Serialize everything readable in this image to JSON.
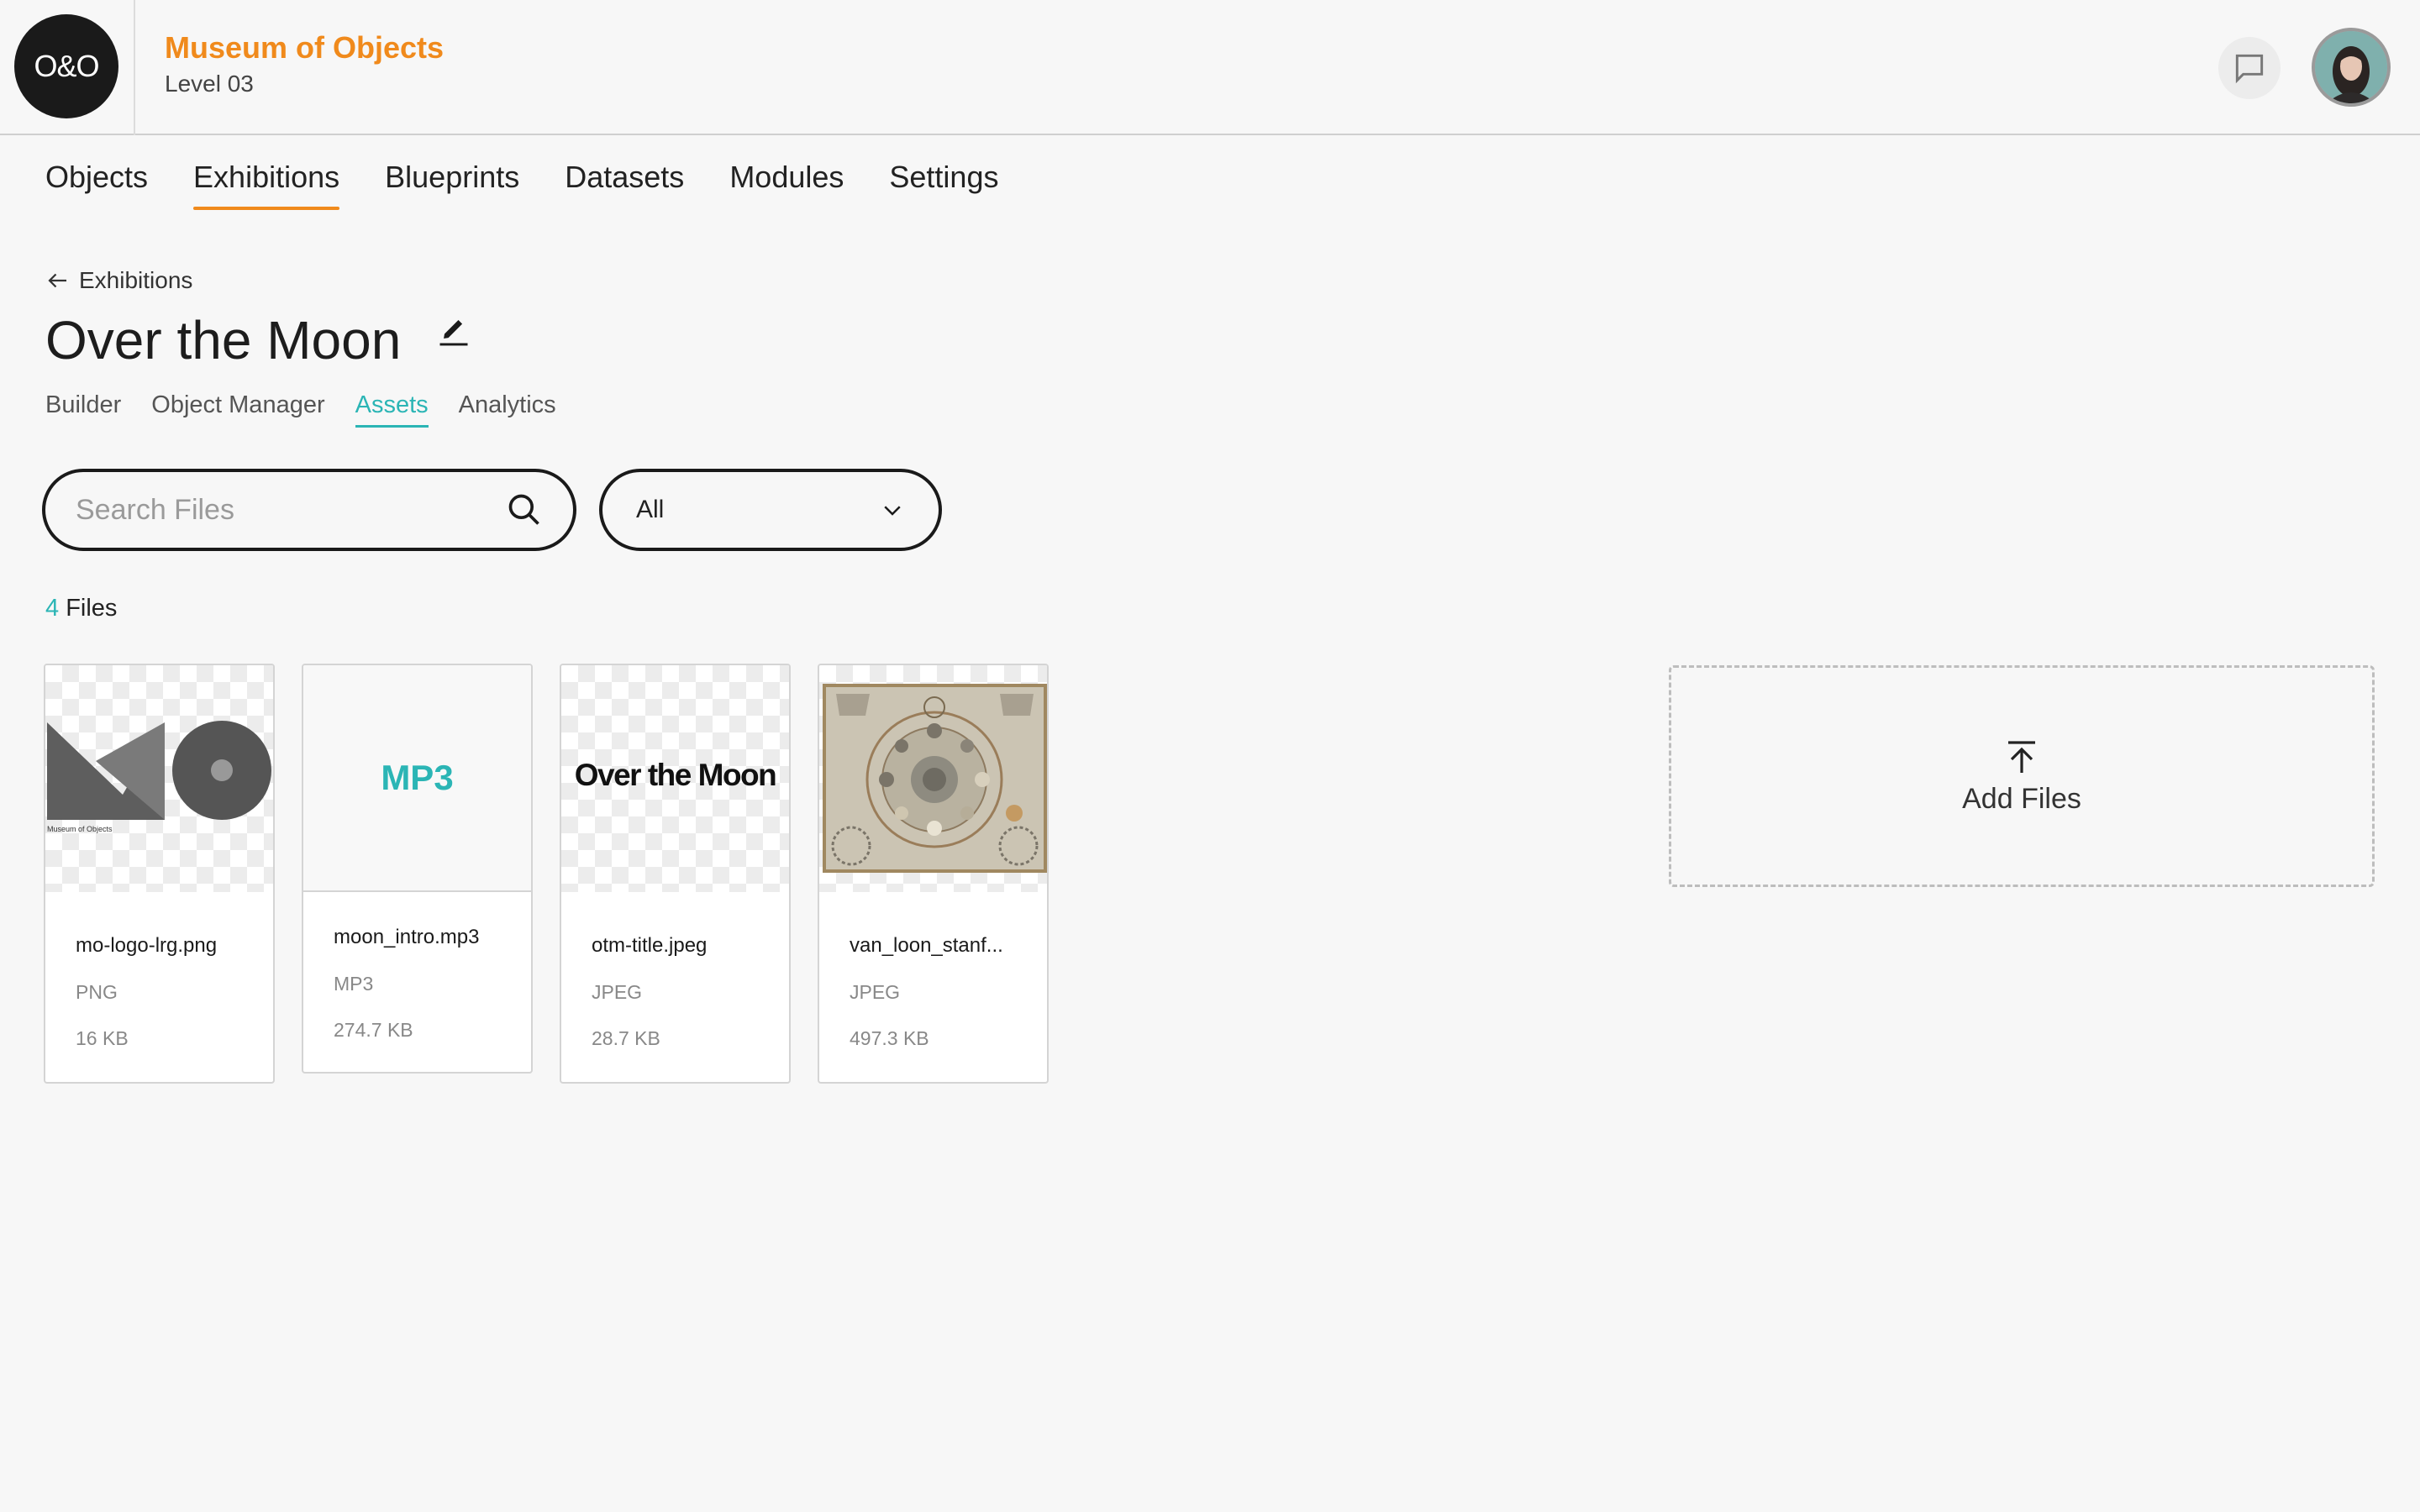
{
  "header": {
    "logo_text": "O&O",
    "org_name": "Museum of Objects",
    "level": "Level 03",
    "chat_icon": "chat-bubble-icon",
    "accent_color": "#f08a1c"
  },
  "main_nav": {
    "items": [
      {
        "label": "Objects"
      },
      {
        "label": "Exhibitions",
        "active": true
      },
      {
        "label": "Blueprints"
      },
      {
        "label": "Datasets"
      },
      {
        "label": "Modules"
      },
      {
        "label": "Settings"
      }
    ]
  },
  "breadcrumb": {
    "label": "Exhibitions",
    "icon": "arrow-left-icon"
  },
  "page": {
    "title": "Over the Moon",
    "edit_icon": "pencil-icon"
  },
  "sub_tabs": {
    "items": [
      {
        "label": "Builder"
      },
      {
        "label": "Object Manager"
      },
      {
        "label": "Assets",
        "active": true
      },
      {
        "label": "Analytics"
      }
    ],
    "active_color": "#2bb5b5"
  },
  "search": {
    "placeholder": "Search Files",
    "value": "",
    "icon": "search-icon"
  },
  "filter": {
    "selected": "All",
    "icon": "chevron-down-icon"
  },
  "files_summary": {
    "count": "4",
    "label": "Files"
  },
  "files": [
    {
      "name": "mo-logo-lrg.png",
      "type": "PNG",
      "size": "16 KB",
      "thumb_caption": "Museum of Objects"
    },
    {
      "name": "moon_intro.mp3",
      "type": "MP3",
      "size": "274.7 KB",
      "thumb_label": "MP3"
    },
    {
      "name": "otm-title.jpeg",
      "type": "JPEG",
      "size": "28.7 KB",
      "thumb_text": "Over the Moon"
    },
    {
      "name": "van_loon_stanf...",
      "type": "JPEG",
      "size": "497.3 KB"
    }
  ],
  "add_files": {
    "label": "Add Files",
    "icon": "upload-icon"
  }
}
